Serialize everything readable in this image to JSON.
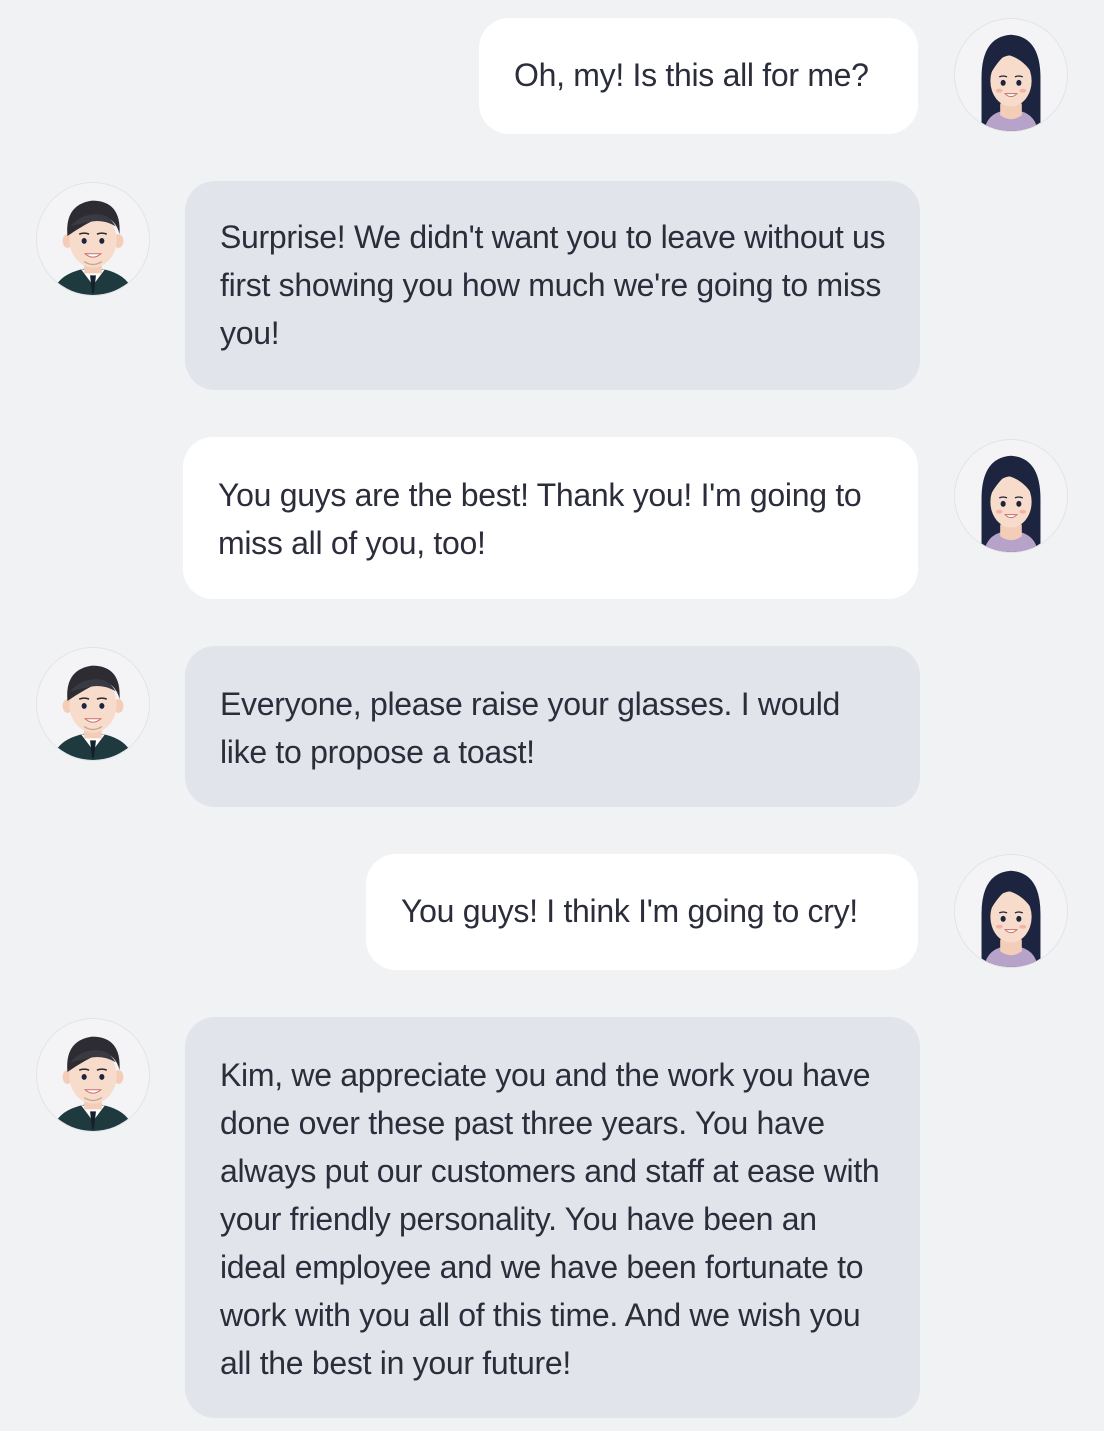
{
  "participants": {
    "her": {
      "role": "Kim",
      "icon": "woman-avatar-icon"
    },
    "him": {
      "role": "colleague",
      "icon": "man-avatar-icon"
    }
  },
  "colors": {
    "background": "#f1f2f4",
    "her_bubble": "#ffffff",
    "his_bubble": "#e1e4ea",
    "text": "#2b2d3b"
  },
  "messages": [
    {
      "speaker": "her",
      "text": "Oh, my! Is this all for me?"
    },
    {
      "speaker": "him",
      "text": "Surprise! We didn't want you to leave without us first showing you how much we're going to miss you!"
    },
    {
      "speaker": "her",
      "text": "You guys are the best! Thank you! I'm going to miss all of you, too!"
    },
    {
      "speaker": "him",
      "text": "Everyone, please raise your glasses. I would like to propose a toast!"
    },
    {
      "speaker": "her",
      "text": "You guys! I think I'm going to cry!"
    },
    {
      "speaker": "him",
      "text": "Kim, we appreciate you and the work you have done over these past three years. You have always put our customers and staff at ease with your friendly personality. You have been an ideal employee and we have been fortunate to work with you all of this time. And we wish you all the best in your future!"
    }
  ]
}
